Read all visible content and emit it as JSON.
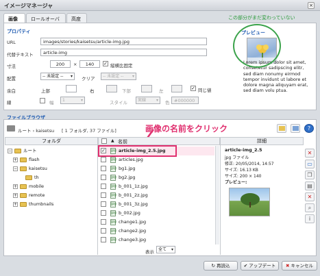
{
  "window": {
    "title": "イメージマネージャ",
    "close": "×"
  },
  "tabs": [
    "画像",
    "ロールオーバー",
    "高度"
  ],
  "annotation_top": "この部分がまだ変わっていない",
  "annotation_mid": "画像の名前をクリック",
  "properties": {
    "heading": "プロパティ",
    "url_label": "URL",
    "url_value": "images/stories/kaisetsu/article-img.jpg",
    "alt_label": "代替テキスト",
    "alt_value": "article-img",
    "size_label": "寸法",
    "width": "200",
    "x": "×",
    "height": "140",
    "ratio_label": "縦横比固定",
    "align_label": "配置",
    "align_value": "-- 未設定 --",
    "clear_label": "クリア",
    "clear_value": "-- 未設定 --",
    "margin_label": "余白",
    "top_label": "上部",
    "right_label": "右",
    "bottom_label": "下部",
    "left_label": "左",
    "same_label": "同じ値",
    "border_label": "線",
    "width_label": "幅",
    "width_value": "1",
    "style_label": "スタイル",
    "style_value": "実線",
    "color_label": "色",
    "color_value": "#000000"
  },
  "preview": {
    "heading": "プレビュー",
    "text": "Lorem ipsum dolor sit amet, consetetur sadipscing elitr, sed diam nonumy eirmod tempor invidunt ut labore et dolore magna aliquyam erat, sed diam volu ptua."
  },
  "browser": {
    "heading": "ファイルブラウザ",
    "path": "ルート › kaisetsu",
    "count": "[ 1 フォルダ, 37 ファイル]",
    "folder_col": "フォルダ",
    "name_col": "名前",
    "detail_col": "詳細",
    "tree": [
      {
        "name": "ルート",
        "level": 0,
        "sign": "−"
      },
      {
        "name": "flash",
        "level": 1,
        "sign": "+"
      },
      {
        "name": "kaisetsu",
        "level": 1,
        "sign": "−"
      },
      {
        "name": "th",
        "level": 2,
        "sign": ""
      },
      {
        "name": "mobile",
        "level": 1,
        "sign": "+"
      },
      {
        "name": "remote",
        "level": 1,
        "sign": "+"
      },
      {
        "name": "thumbnails",
        "level": 1,
        "sign": "+"
      }
    ],
    "files": [
      "article-img_2.5.jpg",
      "articles.jpg",
      "bg1.jpg",
      "bg2.jpg",
      "b_001_1z.jpg",
      "b_001_2z.jpg",
      "b_001_3z.jpg",
      "b_002.jpg",
      "change1.jpg",
      "change2.jpg",
      "change3.jpg"
    ],
    "show_label": "表示",
    "show_value": "全て",
    "detail": {
      "name": "article-img_2.5",
      "type": "jpg ファイル",
      "modified": "修正: 20/05/2014, 14:57",
      "size": "サイズ: 16.13 KB",
      "dims": "サイズ: 200 × 140",
      "preview_label": "プレビュー:"
    }
  },
  "buttons": {
    "refresh": "再読込",
    "update": "アップデート",
    "cancel": "キャンセル"
  }
}
